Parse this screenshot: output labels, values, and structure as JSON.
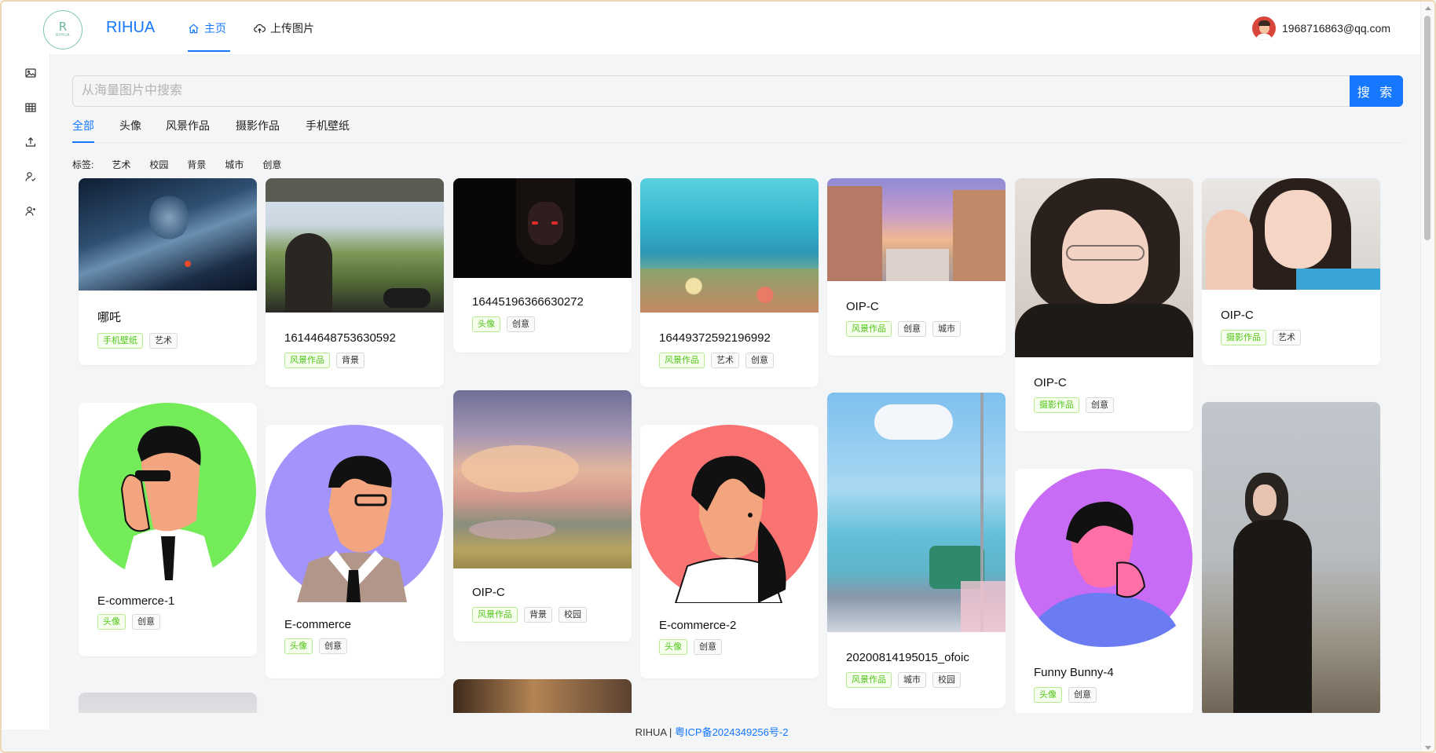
{
  "header": {
    "logo_mark": "R",
    "logo_text": "RIHUA",
    "brand": "RIHUA",
    "nav": [
      {
        "label": "主页",
        "icon": "home-icon",
        "active": true
      },
      {
        "label": "上传图片",
        "icon": "cloud-upload-icon",
        "active": false
      }
    ],
    "user_email": "1968716863@qq.com"
  },
  "sidebar": {
    "icons": [
      "picture-icon",
      "table-icon",
      "upload-icon",
      "team-icon",
      "user-switch-icon"
    ]
  },
  "search": {
    "placeholder": "从海量图片中搜索",
    "button_label": "搜 索"
  },
  "categories": {
    "tabs": [
      "全部",
      "头像",
      "风景作品",
      "摄影作品",
      "手机壁纸"
    ],
    "active": "全部"
  },
  "tag_filter": {
    "label": "标签:",
    "tags": [
      "艺术",
      "校园",
      "背景",
      "城市",
      "创意"
    ]
  },
  "cards": [
    {
      "title": "哪吒",
      "tags": [
        "手机壁纸",
        "艺术"
      ]
    },
    {
      "title": "16144648753630592",
      "tags": [
        "风景作品",
        "背景"
      ]
    },
    {
      "title": "16445196366630272",
      "tags": [
        "头像",
        "创意"
      ]
    },
    {
      "title": "16449372592196992",
      "tags": [
        "风景作品",
        "艺术",
        "创意"
      ]
    },
    {
      "title": "OIP-C",
      "tags": [
        "风景作品",
        "创意",
        "城市"
      ]
    },
    {
      "title": "OIP-C",
      "tags": [
        "摄影作品",
        "创意"
      ]
    },
    {
      "title": "OIP-C",
      "tags": [
        "摄影作品",
        "艺术"
      ]
    },
    {
      "title": "E-commerce-1",
      "tags": [
        "头像",
        "创意"
      ]
    },
    {
      "title": "E-commerce",
      "tags": [
        "头像",
        "创意"
      ]
    },
    {
      "title": "OIP-C",
      "tags": [
        "风景作品",
        "背景",
        "校园"
      ]
    },
    {
      "title": "E-commerce-2",
      "tags": [
        "头像",
        "创意"
      ]
    },
    {
      "title": "20200814195015_ofoic",
      "tags": [
        "风景作品",
        "城市",
        "校园"
      ]
    },
    {
      "title": "Funny Bunny-4",
      "tags": [
        "头像",
        "创意"
      ]
    },
    {
      "title": "",
      "tags": []
    },
    {
      "title": "",
      "tags": []
    },
    {
      "title": "",
      "tags": []
    }
  ],
  "footer": {
    "text": "RIHUA | ",
    "icp": "粤ICP备2024349256号-2"
  },
  "colors": {
    "primary": "#1677ff",
    "green_tag": "#52c41a",
    "logo": "#6cb69c"
  }
}
